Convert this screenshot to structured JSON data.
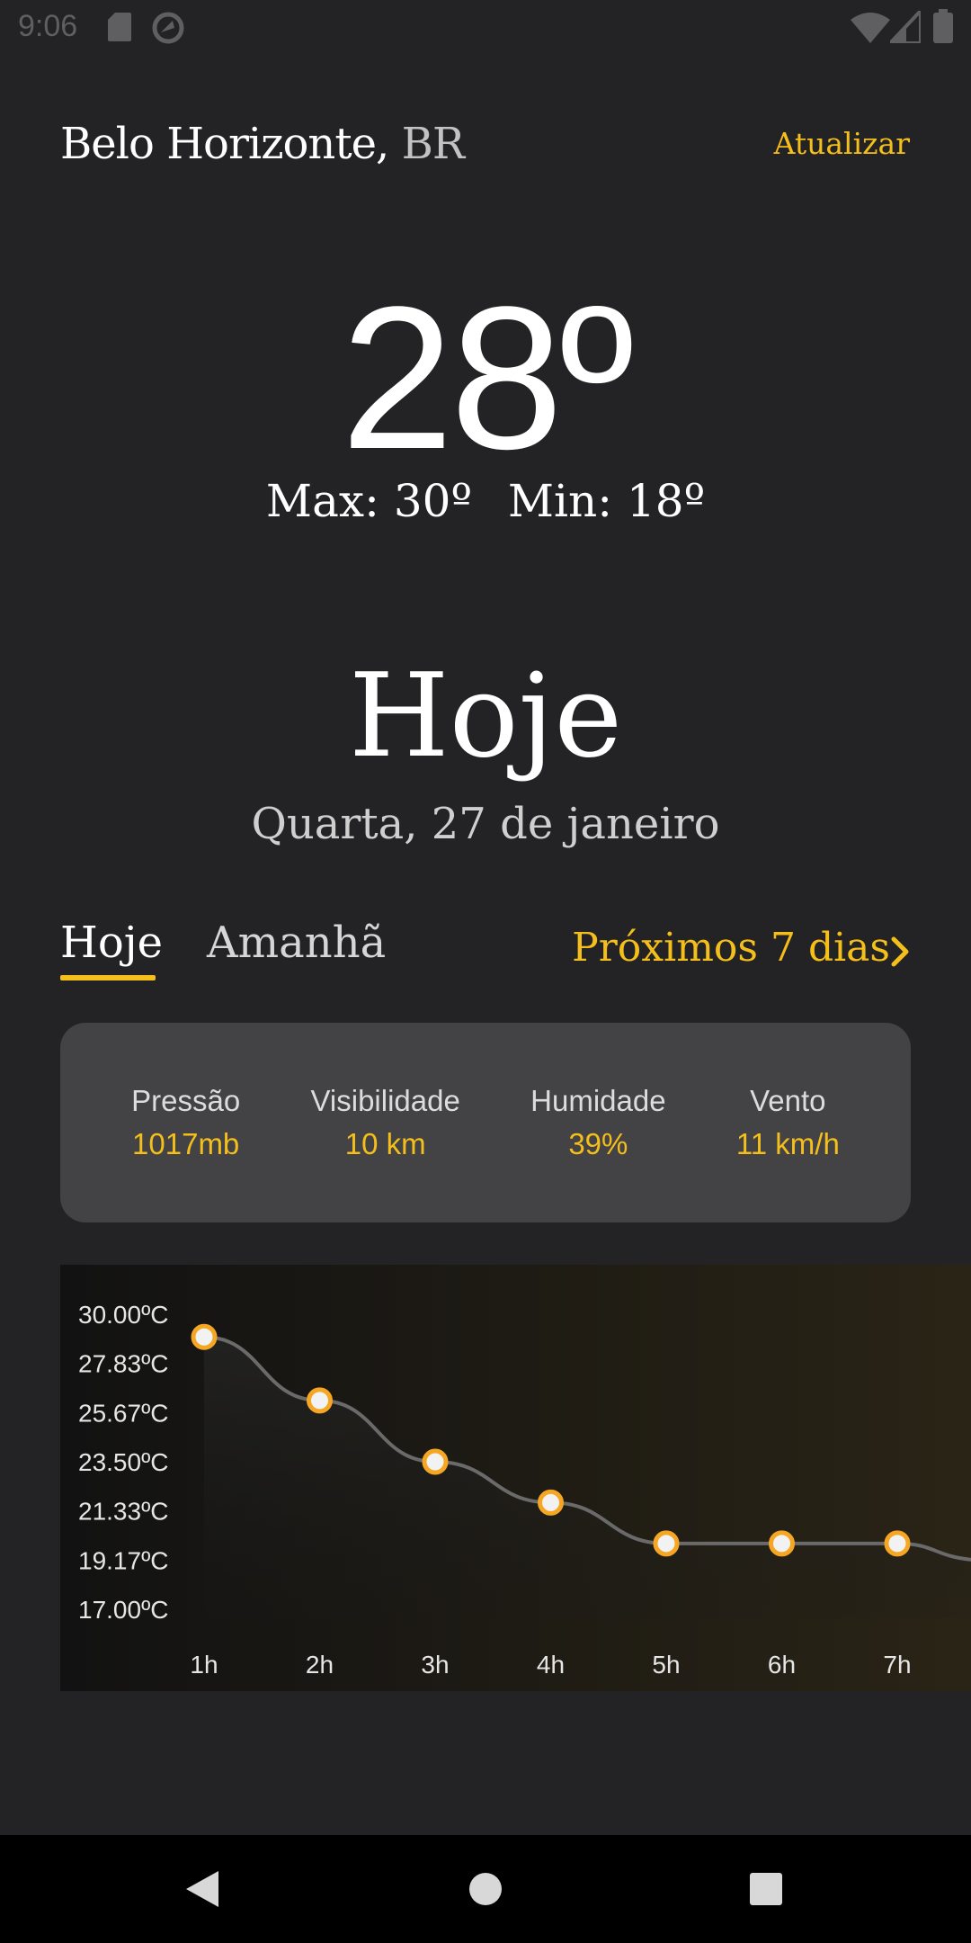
{
  "status_bar": {
    "time": "9:06"
  },
  "header": {
    "city": "Belo Horizonte,",
    "country": "BR",
    "refresh_label": "Atualizar"
  },
  "current": {
    "temperature": "28º",
    "max_label": "Max: 30º",
    "min_label": "Min: 18º"
  },
  "day": {
    "title": "Hoje",
    "date": "Quarta, 27 de janeiro"
  },
  "tabs": {
    "today": "Hoje",
    "tomorrow": "Amanhã",
    "next_days": "Próximos 7 dias"
  },
  "details": [
    {
      "label": "Pressão",
      "value": "1017mb"
    },
    {
      "label": "Visibilidade",
      "value": "10 km"
    },
    {
      "label": "Humidade",
      "value": "39%"
    },
    {
      "label": "Vento",
      "value": "11 km/h"
    }
  ],
  "colors": {
    "accent": "#f5bf1b",
    "background": "#232325",
    "card": "#434345"
  },
  "chart_data": {
    "type": "line",
    "categories": [
      "1h",
      "2h",
      "3h",
      "4h",
      "5h",
      "6h",
      "7h"
    ],
    "values": [
      29.0,
      26.2,
      23.5,
      21.7,
      19.9,
      19.9,
      19.9
    ],
    "y_tick_labels": [
      "30.00ºC",
      "27.83ºC",
      "25.67ºC",
      "23.50ºC",
      "21.33ºC",
      "19.17ºC",
      "17.00ºC"
    ],
    "ylim": [
      17,
      30
    ],
    "point_color": "#f5a623",
    "line_color": "#6a6a6a"
  }
}
